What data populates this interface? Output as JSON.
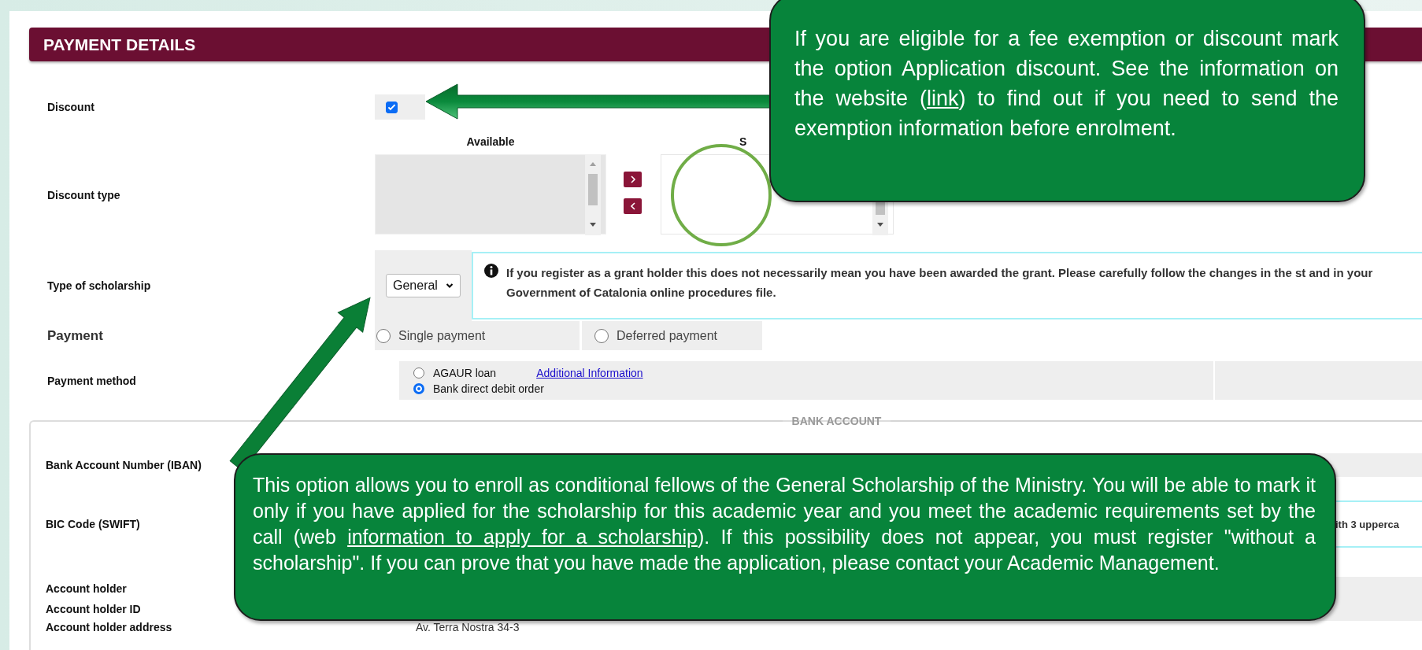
{
  "header": {
    "title": "PAYMENT DETAILS"
  },
  "form": {
    "discount": {
      "label": "Discount",
      "checked": true
    },
    "discount_type": {
      "label": "Discount type",
      "available_heading": "Available",
      "selected_heading": "S"
    },
    "scholarship": {
      "label": "Type of scholarship",
      "value": "General",
      "info": "If you register as a grant holder this does not necessarily mean you have been awarded the grant. Please carefully follow the changes in the st and in your Government of Catalonia online procedures file."
    },
    "payment": {
      "label": "Payment",
      "options": [
        {
          "label": "Single payment",
          "selected": false
        },
        {
          "label": "Deferred payment",
          "selected": false
        }
      ]
    },
    "payment_method": {
      "label": "Payment method",
      "link": "Additional Information",
      "options": [
        {
          "label": "AGAUR loan",
          "selected": false
        },
        {
          "label": "Bank direct debit order",
          "selected": true
        }
      ]
    }
  },
  "bank_account": {
    "legend": "BANK ACCOUNT",
    "fields": [
      {
        "label": "Bank Account Number (IBAN)"
      },
      {
        "label": "BIC Code (SWIFT)",
        "info": "ith 3 upperca"
      },
      {
        "label": "Account holder"
      },
      {
        "label": "Account holder ID"
      },
      {
        "label": "Account holder address",
        "value": "Av. Terra Nostra 34-3"
      }
    ]
  },
  "callouts": [
    {
      "before": "If you are eligible for a fee exemption or discount mark the option Application discount. See the information on the website (",
      "link": "link",
      "after": ") to find out if you need to send the exemption information before enrolment."
    },
    {
      "before": "This option allows you to enroll as conditional fellows of the General Scholarship of the Ministry. You will be able to mark it only if you have applied for the scholarship for this academic year and you meet the academic requirements set by the call (web ",
      "link": "information to apply for a scholarship",
      "after": "). If this possibility does not appear, you must register \"without a scholarship\". If you can prove that you have made the application, please contact your Academic Management."
    }
  ]
}
